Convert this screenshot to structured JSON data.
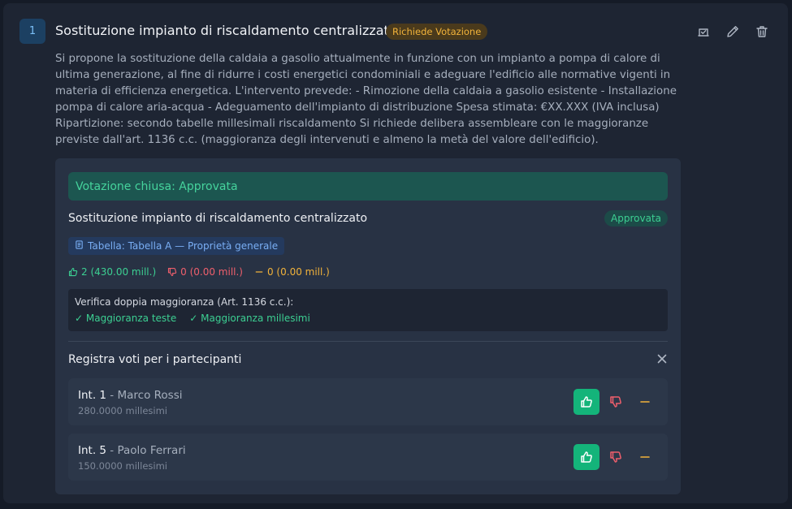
{
  "item": {
    "number": "1",
    "title": "Sostituzione impianto di riscaldamento centralizzato",
    "status": "Richiede Votazione",
    "description": "Si propone la sostituzione della caldaia a gasolio attualmente in funzione con un impianto a pompa di calore di ultima generazione, al fine di ridurre i costi energetici condominiali e adeguare l'edificio alle normative vigenti in materia di efficienza energetica. L'intervento prevede: - Rimozione della caldaia a gasolio esistente - Installazione pompa di calore aria-acqua - Adeguamento dell'impianto di distribuzione Spesa stimata: €XX.XXX (IVA inclusa) Ripartizione: secondo tabelle millesimali riscaldamento Si richiede delibera assembleare con le maggioranze previste dall'art. 1136 c.c. (maggioranza degli intervenuti e almeno la metà del valore dell'edificio).",
    "icons": [
      "vote-box-icon",
      "pencil-icon",
      "trash-icon"
    ]
  },
  "vote": {
    "banner": "Votazione chiusa: Approvata",
    "title": "Sostituzione impianto di riscaldamento centralizzato",
    "result": "Approvata",
    "table": "Tabella: Tabella A — Proprietà generale",
    "counts": {
      "yes": "2 (430.00 mill.)",
      "no": "0 (0.00 mill.)",
      "abstain": "0 (0.00 mill.)"
    },
    "majority": {
      "title": "Verifica doppia maggioranza (Art. 1136 c.c.):",
      "check_heads": "✓ Maggioranza teste",
      "check_millesimi": "✓ Maggioranza millesimi"
    }
  },
  "register": {
    "title": "Registra voti per i partecipanti",
    "participants": [
      {
        "unit": "Int. 1",
        "separator": " - ",
        "name": "Marco Rossi",
        "millesimi": "280.0000 millesimi"
      },
      {
        "unit": "Int. 5",
        "separator": " - ",
        "name": "Paolo Ferrari",
        "millesimi": "150.0000 millesimi"
      }
    ]
  },
  "colors": {
    "accent_green": "#14b47a",
    "warning_amber": "#f1b23a",
    "danger_red": "#ef5f6c",
    "info_blue": "#79aef4"
  }
}
